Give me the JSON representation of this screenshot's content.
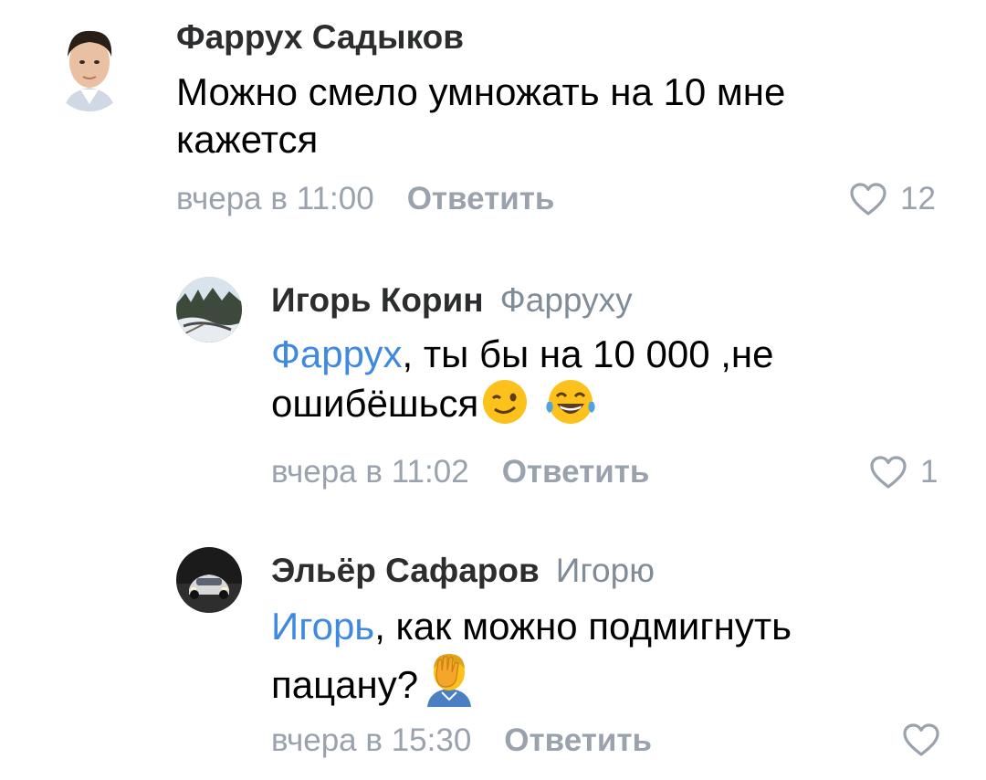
{
  "comments": [
    {
      "author": "Фаррух Садыков",
      "reply_to": "",
      "mention": "",
      "text_line1": "Можно смело умножать на 10 мне",
      "text_line2": "кажется",
      "time": "вчера в 11:00",
      "reply_label": "Ответить",
      "likes": "12"
    },
    {
      "author": "Игорь Корин",
      "reply_to": "Фарруху",
      "mention": "Фаррух",
      "text_line1": ", ты бы на 10 000 ,не",
      "text_line2": "ошибёшься",
      "time": "вчера в 11:02",
      "reply_label": "Ответить",
      "likes": "1"
    },
    {
      "author": "Эльёр Сафаров",
      "reply_to": "Игорю",
      "mention": "Игорь",
      "text_line1": ", как можно подмигнуть",
      "text_line2": "пацану?",
      "time": "вчера в 15:30",
      "reply_label": "Ответить",
      "likes": ""
    }
  ],
  "icons": {
    "like": "heart-outline-icon",
    "emoji_wink": "winking-face-emoji",
    "emoji_laugh": "face-with-tears-of-joy-emoji",
    "emoji_facepalm": "person-facepalming-emoji"
  },
  "colors": {
    "mention": "#3f8ae0",
    "secondary": "#99a2ad",
    "author": "#2c2d2e"
  }
}
